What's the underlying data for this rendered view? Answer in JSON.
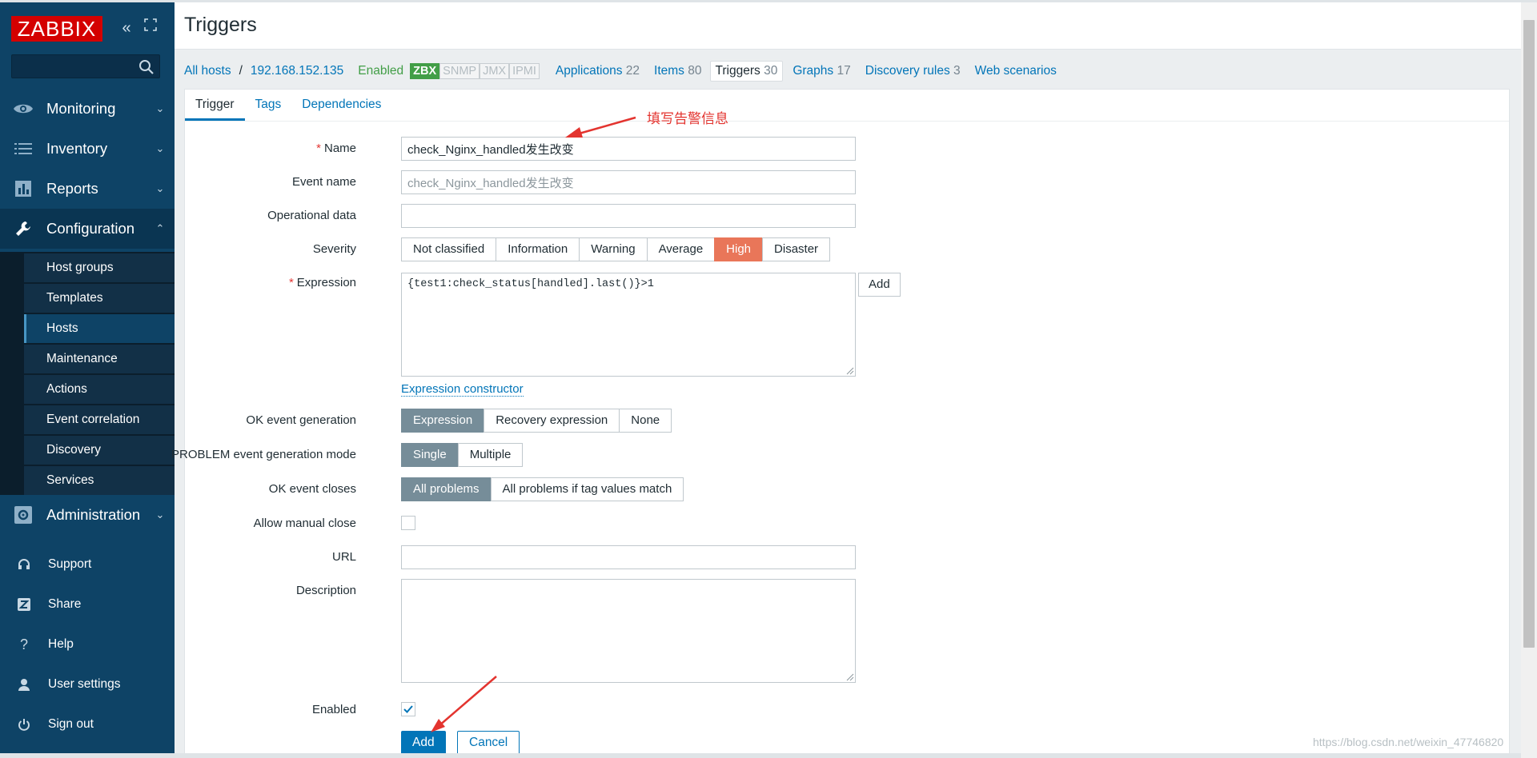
{
  "sidebar": {
    "logo": "ZABBIX",
    "search_placeholder": "",
    "menu": [
      {
        "label": "Monitoring"
      },
      {
        "label": "Inventory"
      },
      {
        "label": "Reports"
      },
      {
        "label": "Configuration"
      },
      {
        "label": "Administration"
      }
    ],
    "submenu": [
      {
        "label": "Host groups"
      },
      {
        "label": "Templates"
      },
      {
        "label": "Hosts"
      },
      {
        "label": "Maintenance"
      },
      {
        "label": "Actions"
      },
      {
        "label": "Event correlation"
      },
      {
        "label": "Discovery"
      },
      {
        "label": "Services"
      }
    ],
    "bottom": [
      {
        "label": "Support"
      },
      {
        "label": "Share"
      },
      {
        "label": "Help"
      },
      {
        "label": "User settings"
      },
      {
        "label": "Sign out"
      }
    ]
  },
  "page": {
    "title": "Triggers"
  },
  "host_nav": {
    "all_hosts": "All hosts",
    "separator": "/",
    "host": "192.168.152.135",
    "status": "Enabled",
    "availability": [
      "ZBX",
      "SNMP",
      "JMX",
      "IPMI"
    ],
    "applications": {
      "label": "Applications",
      "count": "22"
    },
    "items": {
      "label": "Items",
      "count": "80"
    },
    "triggers": {
      "label": "Triggers",
      "count": "30"
    },
    "graphs": {
      "label": "Graphs",
      "count": "17"
    },
    "discovery": {
      "label": "Discovery rules",
      "count": "3"
    },
    "web": {
      "label": "Web scenarios"
    }
  },
  "tabs": [
    "Trigger",
    "Tags",
    "Dependencies"
  ],
  "form": {
    "name": {
      "label": "Name",
      "value": "check_Nginx_handled发生改变"
    },
    "event_name": {
      "label": "Event name",
      "placeholder": "check_Nginx_handled发生改变"
    },
    "operational_data": {
      "label": "Operational data",
      "value": ""
    },
    "severity": {
      "label": "Severity",
      "options": [
        "Not classified",
        "Information",
        "Warning",
        "Average",
        "High",
        "Disaster"
      ],
      "selected": "High"
    },
    "expression": {
      "label": "Expression",
      "value": "{test1:check_status[handled].last()}>1",
      "add_label": "Add",
      "constructor_link": "Expression constructor"
    },
    "ok_event_generation": {
      "label": "OK event generation",
      "options": [
        "Expression",
        "Recovery expression",
        "None"
      ],
      "selected": "Expression"
    },
    "problem_mode": {
      "label": "PROBLEM event generation mode",
      "options": [
        "Single",
        "Multiple"
      ],
      "selected": "Single"
    },
    "ok_event_closes": {
      "label": "OK event closes",
      "options": [
        "All problems",
        "All problems if tag values match"
      ],
      "selected": "All problems"
    },
    "allow_manual_close": {
      "label": "Allow manual close",
      "checked": false
    },
    "url": {
      "label": "URL",
      "value": ""
    },
    "description": {
      "label": "Description",
      "value": ""
    },
    "enabled": {
      "label": "Enabled",
      "checked": true
    },
    "add_button": "Add",
    "cancel_button": "Cancel"
  },
  "annotation": "填写告警信息",
  "watermark": "https://blog.csdn.net/weixin_47746820",
  "colors": {
    "sidebar": "#0e4366",
    "logo": "#d40000",
    "link": "#0275b8",
    "high": "#e97659",
    "selected": "#768d99",
    "annotation": "#e3342f"
  }
}
